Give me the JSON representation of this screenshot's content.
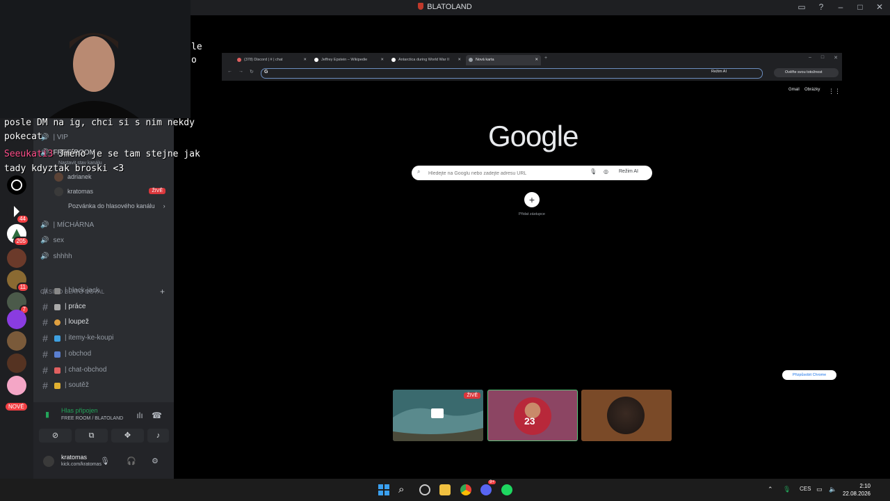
{
  "window": {
    "title": "BLATOLAND"
  },
  "overlay": {
    "chat_line1": "posle DM na ig, chci si s nim nekdy",
    "chat_line2": "pokecat",
    "chat_nick": "Seeukati3",
    "chat_line3": "Jméno je se tam stejne jak",
    "chat_line4": "tady kdyztak broski <3",
    "side_fragment1": "le",
    "side_fragment2": "o"
  },
  "servers": [
    {
      "badge": ""
    },
    {
      "badge": ""
    },
    {
      "badge": "44"
    },
    {
      "badge": "205"
    },
    {
      "badge": ""
    },
    {
      "badge": "11"
    },
    {
      "badge": "7"
    },
    {
      "badge": ""
    },
    {
      "badge": ""
    },
    {
      "badge": ""
    },
    {
      "badge": ""
    }
  ],
  "nove_label": "NOVÉ",
  "channels": {
    "vip": "| VIP",
    "free_room": "FREE ROOM",
    "status_hint": "Nastavit stav kanálu",
    "zive": "ŽIVĚ",
    "users": [
      "adrianek",
      "kratomas"
    ],
    "invite": "Pozvánka do hlasového kanálu",
    "michrna": "| MÍCHÁRNA",
    "sex": "sex",
    "shhhh": "shhhh",
    "category": "CASINO BLATO ROYAL",
    "text": [
      "| black-jack",
      "| práce",
      "| loupež",
      "| itemy-ke-koupi",
      "| obchod",
      "| chat-obchod",
      "| soutěž"
    ]
  },
  "voice": {
    "status": "Hlas připojen",
    "room": "FREE ROOM / BLATOLAND"
  },
  "user": {
    "name": "kratomas",
    "sub": "kick.com/kratomas"
  },
  "browser": {
    "tabs": [
      "(378) Discord | # | chat",
      "Jeffrey Epstein – Wikipedie",
      "Antarctica during World War II",
      "Nová karta"
    ],
    "rezim_ai": "Režim AI",
    "overit": "Ověřte svou totožnost",
    "gmail": "Gmail",
    "obrazky": "Obrázky",
    "search_placeholder": "Hledejte na Googlu nebo zadejte adresu URL",
    "add_shortcut": "Přidat zástupce",
    "customize": "Přizpůsobit Chrome",
    "logo": "Google"
  },
  "tiles": {
    "zive": "ŽIVĚ",
    "tile2_number": "23"
  },
  "taskbar": {
    "lang": "CES",
    "time": "2:10",
    "date": "22.08.2026",
    "discord_badge": "9+"
  },
  "colors": {
    "discord_bg": "#2b2d31",
    "accent_green": "#23a55a",
    "live_red": "#da373c"
  }
}
